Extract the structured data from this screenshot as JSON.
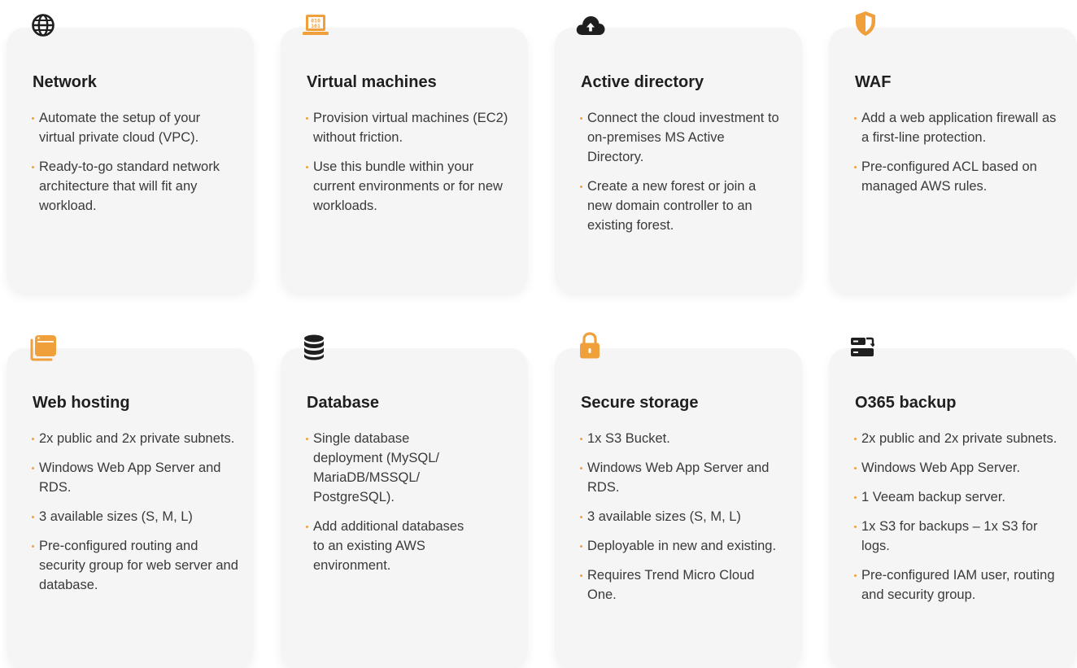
{
  "accent_color": "#f0a03a",
  "dark_color": "#2b2b2b",
  "cards": [
    {
      "title": "Network",
      "icon": "globe-icon",
      "bullets": [
        "Automate the setup of your virtual private cloud (VPC).",
        "Ready-to-go standard network architecture that will fit any workload."
      ]
    },
    {
      "title": "Virtual machines",
      "icon": "laptop-binary-icon",
      "bullets": [
        "Provision virtual machines (EC2) without friction.",
        "Use this bundle within your current environments or for new workloads."
      ]
    },
    {
      "title": "Active directory",
      "icon": "cloud-upload-icon",
      "bullets": [
        "Connect the cloud investment to on-premises MS Active Directory.",
        "Create a new forest or join a new domain controller to an existing forest."
      ]
    },
    {
      "title": "WAF",
      "icon": "shield-icon",
      "bullets": [
        "Add a web application firewall as a first-line protection.",
        "Pre-configured ACL based on managed AWS rules."
      ]
    },
    {
      "title": "Web hosting",
      "icon": "browser-window-icon",
      "bullets": [
        "2x public and 2x private subnets.",
        "Windows Web App Server and RDS.",
        "3 available sizes (S, M, L)",
        "Pre-configured routing and security group for web server and database."
      ]
    },
    {
      "title": "Database",
      "icon": "database-icon",
      "bullets": [
        "Single database deployment (MySQL/ MariaDB/MSSQL/ PostgreSQL).",
        "Add additional databases to an existing AWS environment."
      ]
    },
    {
      "title": "Secure storage",
      "icon": "lock-icon",
      "bullets": [
        "1x S3 Bucket.",
        "Windows Web App Server and RDS.",
        "3 available sizes (S, M, L)",
        "Deployable in new and existing.",
        "Requires Trend Micro Cloud One."
      ]
    },
    {
      "title": "O365 backup",
      "icon": "server-transfer-icon",
      "bullets": [
        "2x public and 2x private subnets.",
        "Windows Web App Server.",
        "1 Veeam backup server.",
        "1x S3 for backups – 1x S3 for logs.",
        "Pre-configured IAM user, routing and security group."
      ]
    }
  ]
}
